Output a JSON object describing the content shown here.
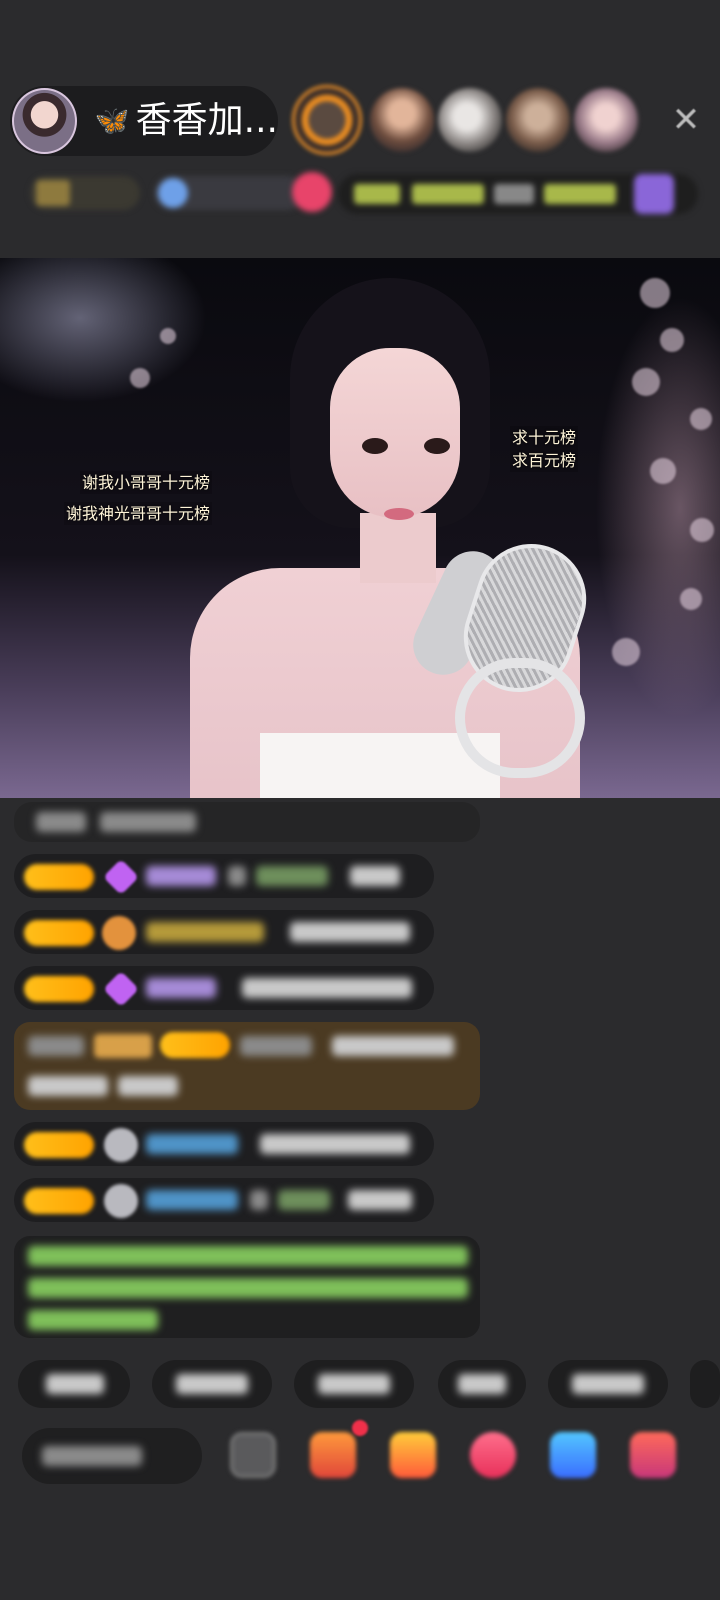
{
  "header": {
    "host_name": "香香加...",
    "host_badge_icon": "butterfly-icon",
    "close_icon": "close-icon"
  },
  "video_overlay": {
    "left_lines": [
      "谢我小哥哥十元榜",
      "谢我神光哥哥十元榜"
    ],
    "right_lines": [
      "求十元榜",
      "求百元榜"
    ]
  },
  "colors": {
    "background": "#2b2b2d",
    "level_badge": "#ffb31a",
    "overlay_text": "#fff5d9"
  }
}
